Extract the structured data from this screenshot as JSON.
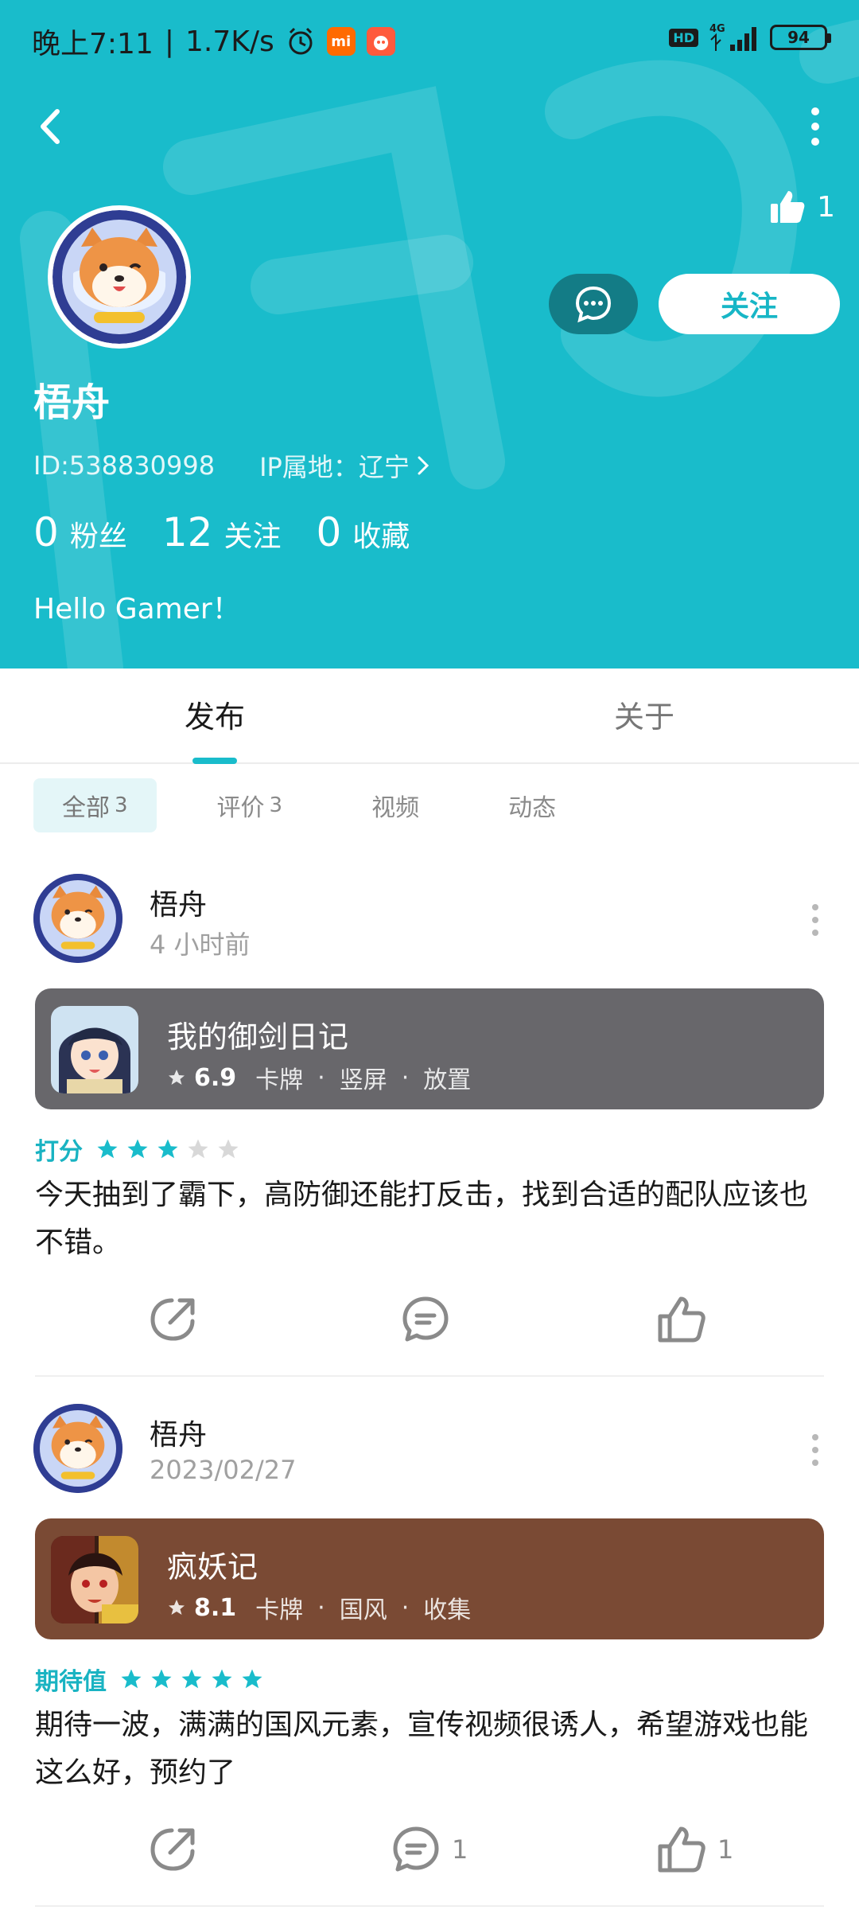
{
  "status_bar": {
    "time": "晚上7:11",
    "net_speed": "1.7K/s",
    "hd": "HD",
    "network": "4G",
    "battery": "94"
  },
  "profile": {
    "name": "梧舟",
    "id_text": "ID:538830998",
    "ip_text": "IP属地：辽宁",
    "likes": "1",
    "follow_label": "关注",
    "stats": [
      {
        "num": "0",
        "label": "粉丝"
      },
      {
        "num": "12",
        "label": "关注"
      },
      {
        "num": "0",
        "label": "收藏"
      }
    ],
    "bio": "Hello Gamer！"
  },
  "tabs": {
    "publish": "发布",
    "about": "关于"
  },
  "filters": [
    {
      "label": "全部",
      "count": "3"
    },
    {
      "label": "评价",
      "count": "3"
    },
    {
      "label": "视频",
      "count": ""
    },
    {
      "label": "动态",
      "count": ""
    }
  ],
  "posts": [
    {
      "author": "梧舟",
      "time": "4 小时前",
      "game": {
        "name": "我的御剑日记",
        "score": "6.9",
        "tags": [
          "卡牌",
          "竖屏",
          "放置"
        ],
        "card_color": "#68676b"
      },
      "rating_label": "打分",
      "stars": 3,
      "text": "今天抽到了霸下，高防御还能打反击，找到合适的配队应该也不错。",
      "comments": "",
      "likes": ""
    },
    {
      "author": "梧舟",
      "time": "2023/02/27",
      "game": {
        "name": "疯妖记",
        "score": "8.1",
        "tags": [
          "卡牌",
          "国风",
          "收集"
        ],
        "card_color": "#7a4a34"
      },
      "rating_label": "期待值",
      "stars": 5,
      "text": "期待一波，满满的国风元素，宣传视频很诱人，希望游戏也能这么好，预约了",
      "comments": "1",
      "likes": "1"
    }
  ],
  "colors": {
    "accent": "#19bccb",
    "star_on": "#19bccb",
    "star_off": "#d8d8d8"
  }
}
